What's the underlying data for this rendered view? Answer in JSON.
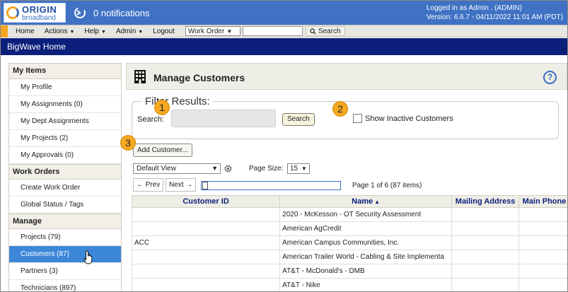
{
  "header": {
    "logo_line1": "ORIGIN",
    "logo_line2": "broadband",
    "notifications": "0 notifications",
    "login_line": "Logged in as Admin . (ADMIN)",
    "version_line": "Version: 6.6.7 - 04/11/2022 11:01 AM (PDT)"
  },
  "menu": {
    "items": [
      {
        "label": "Home"
      },
      {
        "label": "Actions"
      },
      {
        "label": "Help"
      },
      {
        "label": "Admin"
      },
      {
        "label": "Logout"
      }
    ],
    "search_type": "Work Order",
    "search_button": "Search",
    "accent_color": "#f5a623"
  },
  "page_bar": {
    "title": "BigWave Home"
  },
  "sidebar": {
    "sections": [
      {
        "title": "My Items",
        "items": [
          "My Profile",
          "My Assignments (0)",
          "My Dept Assignments",
          "My Projects (2)",
          "My Approvals (0)"
        ]
      },
      {
        "title": "Work Orders",
        "items": [
          "Create Work Order",
          "Global Status / Tags"
        ]
      },
      {
        "title": "Manage",
        "items": [
          "Projects (79)",
          "Customers (87)",
          "Partners (3)",
          "Technicians (897)"
        ]
      }
    ],
    "active_item": "Customers (87)"
  },
  "main": {
    "title": "Manage Customers",
    "help": "?",
    "filter": {
      "legend": "Filter Results:",
      "search_label": "Search:",
      "search_value": "",
      "search_button": "Search",
      "inactive_label": "Show Inactive Customers",
      "inactive_checked": false
    },
    "badges": [
      "1",
      "2",
      "3"
    ],
    "add_button": "Add Customer...",
    "view_select": "Default View",
    "page_size_label": "Page Size:",
    "page_size": "15",
    "prev_label": "Prev",
    "next_label": "Next",
    "page_info": "Page 1 of 6 (87 items)",
    "columns": [
      "Customer ID",
      "Name",
      "Mailing Address",
      "Main Phone"
    ],
    "rows": [
      {
        "id": "",
        "name": "2020 - McKesson - OT Security Assessment",
        "address": "",
        "phone": ""
      },
      {
        "id": "",
        "name": "American AgCredit",
        "address": "",
        "phone": ""
      },
      {
        "id": "ACC",
        "name": "American Campus Communities, Inc.",
        "address": "",
        "phone": ""
      },
      {
        "id": "",
        "name": "American Trailer World - Cabling & Site Implementa",
        "address": "",
        "phone": ""
      },
      {
        "id": "",
        "name": "AT&T - McDonald's - DMB",
        "address": "",
        "phone": ""
      },
      {
        "id": "",
        "name": "AT&T - Nike",
        "address": "",
        "phone": ""
      }
    ]
  },
  "colors": {
    "header_blue": "#3f72c4",
    "page_bar_navy": "#0b1f7b",
    "active_blue": "#3d87d9",
    "badge_orange": "#f6a821"
  }
}
